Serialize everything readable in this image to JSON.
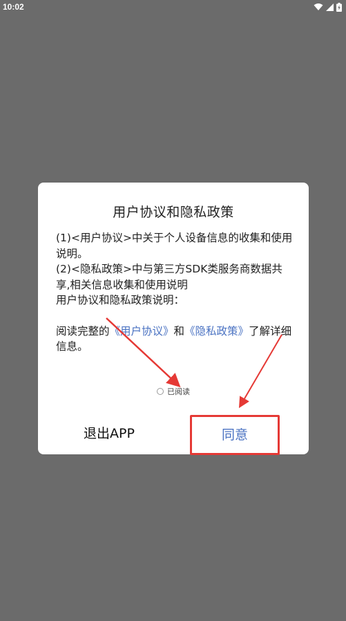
{
  "status_bar": {
    "time": "10:02",
    "icons": [
      "wifi-icon",
      "cellular-signal-icon",
      "battery-charging-icon"
    ]
  },
  "dialog": {
    "title": "用户协议和隐私政策",
    "lines": [
      "(1)<用户协议>中关于个人设备信息的收集和使用说明。",
      "(2)<隐私政策>中与第三方SDK类服务商数据共享,相关信息收集和使用说明",
      "用户协议和隐私政策说明："
    ],
    "read_notice": {
      "prefix": "阅读完整的",
      "user_agreement_link": "《用户协议》",
      "and": "和",
      "privacy_policy_link": "《隐私政策》",
      "suffix": "了解详细信息。"
    },
    "read_checkbox_label": "已阅读",
    "exit_button": "退出APP",
    "agree_button": "同意"
  },
  "colors": {
    "overlay": "#6b6b6b",
    "link": "#4a72c2",
    "annotation": "#e53935"
  }
}
